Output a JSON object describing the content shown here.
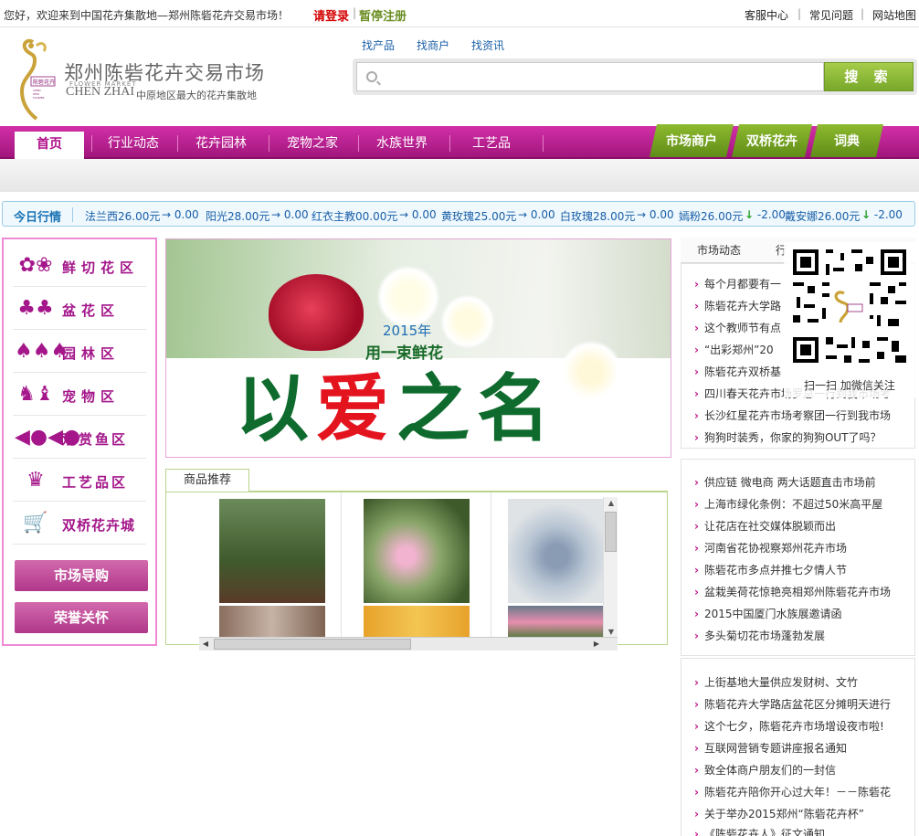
{
  "topbar": {
    "welcome": "您好，欢迎来到中国花卉集散地—郑州陈砦花卉交易市场！",
    "login": "请登录",
    "register": "暂停注册",
    "links": [
      "客服中心",
      "常见问题",
      "网站地图"
    ]
  },
  "logo": {
    "cn": "郑州陈砦花卉交易市场",
    "market": "FLOWER MARKET",
    "en": "CHEN ZHAI",
    "tag": "中原地区最大的花卉集散地"
  },
  "search": {
    "links": [
      "找产品",
      "找商户",
      "找资讯"
    ],
    "placeholder": "",
    "button": "搜 索"
  },
  "nav": {
    "items": [
      "首页",
      "行业动态",
      "花卉园林",
      "宠物之家",
      "水族世界",
      "工艺品"
    ],
    "green": [
      "市场商户",
      "双桥花卉",
      "词典"
    ]
  },
  "ticker": {
    "label": "今日行情",
    "items": [
      {
        "name": "法兰西26.00元",
        "change": "0.00",
        "dir": "→"
      },
      {
        "name": "阳光28.00元",
        "change": "0.00",
        "dir": "→"
      },
      {
        "name": "红衣主教00.00元",
        "change": "0.00",
        "dir": "→"
      },
      {
        "name": "黄玫瑰25.00元",
        "change": "0.00",
        "dir": "→"
      },
      {
        "name": "白玫瑰28.00元",
        "change": "0.00",
        "dir": "→"
      },
      {
        "name": "嫣粉26.00元",
        "change": "-2.00",
        "dir": "↓"
      },
      {
        "name": "戴安娜26.00元",
        "change": "-2.00",
        "dir": "↓"
      }
    ]
  },
  "categories": [
    {
      "label": "鲜切花区",
      "icon": "flower-icon"
    },
    {
      "label": "盆花区",
      "icon": "potted-plant-icon"
    },
    {
      "label": "园林区",
      "icon": "trees-icon"
    },
    {
      "label": "宠物区",
      "icon": "pet-icon"
    },
    {
      "label": "观赏鱼区",
      "icon": "fish-icon"
    },
    {
      "label": "工艺品区",
      "icon": "crown-icon"
    },
    {
      "label": "双桥花卉城",
      "icon": "cart-icon"
    }
  ],
  "left_buttons": [
    "市场导购",
    "荣誉关怀"
  ],
  "banner": {
    "year": "2015年",
    "slogan": "用一束鲜花",
    "big_a": "以",
    "big_b": "爱",
    "big_c": "之名"
  },
  "products": {
    "tab": "商品推荐"
  },
  "news": {
    "tabs": [
      "市场动态",
      "行"
    ],
    "qr_caption": "扫一扫 加微信关注",
    "group1": [
      "每个月都要有一",
      "陈砦花卉大学路",
      "这个教师节有点",
      "“出彩郑州”20",
      "陈砦花卉双桥基",
      "四川春天花卉市场罗总一行到我市场考",
      "长沙红星花卉市场考察团一行到我市场",
      "狗狗时装秀，你家的狗狗OUT了吗？"
    ],
    "group2": [
      "供应链 微电商 两大话题直击市场前",
      "上海市绿化条例：不超过50米高平屋",
      "让花店在社交媒体脱颖而出",
      "河南省花协视察郑州花卉市场",
      "陈砦花市多点并推七夕情人节",
      "盆栽美荷花惊艳亮相郑州陈砦花卉市场",
      "2015中国厦门水族展邀请函",
      "多头菊切花市场蓬勃发展"
    ],
    "group3": [
      "上街基地大量供应发财树、文竹",
      "陈砦花卉大学路店盆花区分摊明天进行",
      "这个七夕，陈砦花卉市场增设夜市啦!",
      "互联网营销专题讲座报名通知",
      "致全体商户朋友们的一封信",
      "陈砦花卉陪你开心过大年！－－陈砦花",
      "关于举办2015郑州“陈砦花卉杯”",
      "《陈砦花卉人》征文通知"
    ]
  },
  "colors": {
    "brand": "#a4168a",
    "nav_green": "#78a82a",
    "link_blue": "#1a5fa8"
  }
}
